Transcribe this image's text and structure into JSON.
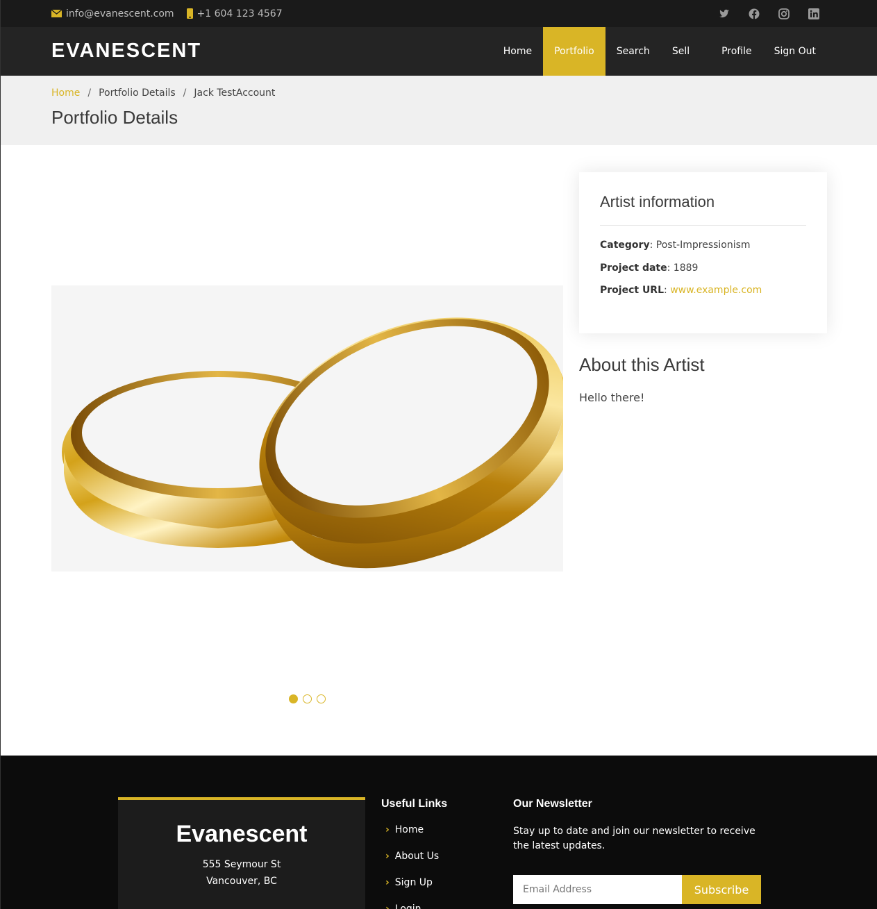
{
  "topbar": {
    "email": "info@evanescent.com",
    "phone": "+1 604 123 4567",
    "social_icons": [
      "twitter-icon",
      "facebook-icon",
      "instagram-icon",
      "linkedin-icon"
    ]
  },
  "header": {
    "logo": "EVANESCENT",
    "nav": [
      "Home",
      "Portfolio",
      "Search",
      "Sell",
      "Profile",
      "Sign Out"
    ],
    "active_nav": "Portfolio"
  },
  "breadcrumb": {
    "items": [
      "Home",
      "Portfolio Details",
      "Jack TestAccount"
    ],
    "page_title": "Portfolio Details"
  },
  "gallery": {
    "image_description": "gold-rings-image",
    "slides": 3,
    "active_slide": 1
  },
  "artist_info": {
    "title": "Artist information",
    "category_label": "Category",
    "category_value": "Post-Impressionism",
    "date_label": "Project date",
    "date_value": "1889",
    "url_label": "Project URL",
    "url_value": "www.example.com"
  },
  "about": {
    "title": "About this Artist",
    "text": "Hello there!"
  },
  "footer": {
    "brand": "Evanescent",
    "address_line1": "555 Seymour St",
    "address_line2": "Vancouver, BC",
    "links_title": "Useful Links",
    "links": [
      "Home",
      "About Us",
      "Sign Up",
      "Login"
    ],
    "newsletter_title": "Our Newsletter",
    "newsletter_text": "Stay up to date and join our newsletter to receive the latest updates.",
    "email_placeholder": "Email Address",
    "subscribe_label": "Subscribe"
  },
  "colors": {
    "accent": "#d9b526",
    "topbar": "#1a1a1a",
    "header": "#242424",
    "footer": "#0c0c0c"
  }
}
